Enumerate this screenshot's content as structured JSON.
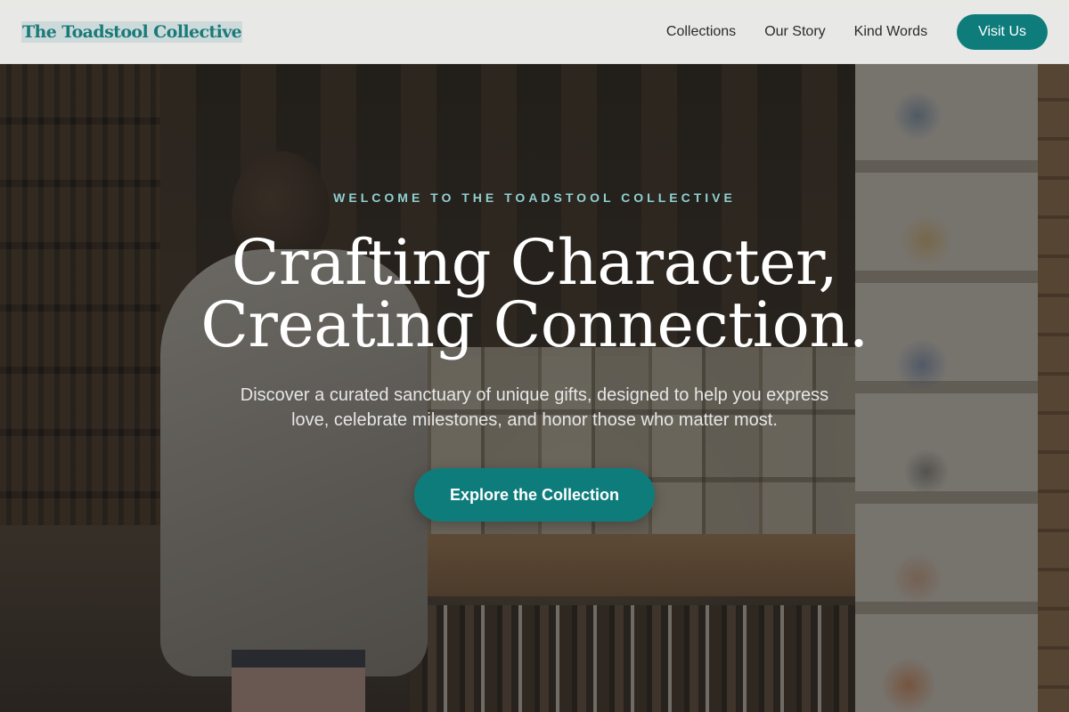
{
  "brand": {
    "name": "The Toadstool Collective",
    "accent_color": "#0f7c7c"
  },
  "nav": {
    "items": [
      {
        "label": "Collections"
      },
      {
        "label": "Our Story"
      },
      {
        "label": "Kind Words"
      }
    ],
    "cta_label": "Visit Us"
  },
  "hero": {
    "eyebrow": "WELCOME TO THE TOADSTOOL COLLECTIVE",
    "headline_line1": "Crafting Character,",
    "headline_line2": "Creating Connection.",
    "subtext": "Discover a curated sanctuary of unique gifts, designed to help you express love, celebrate milestones, and honor those who matter most.",
    "cta_label": "Explore the Collection"
  }
}
